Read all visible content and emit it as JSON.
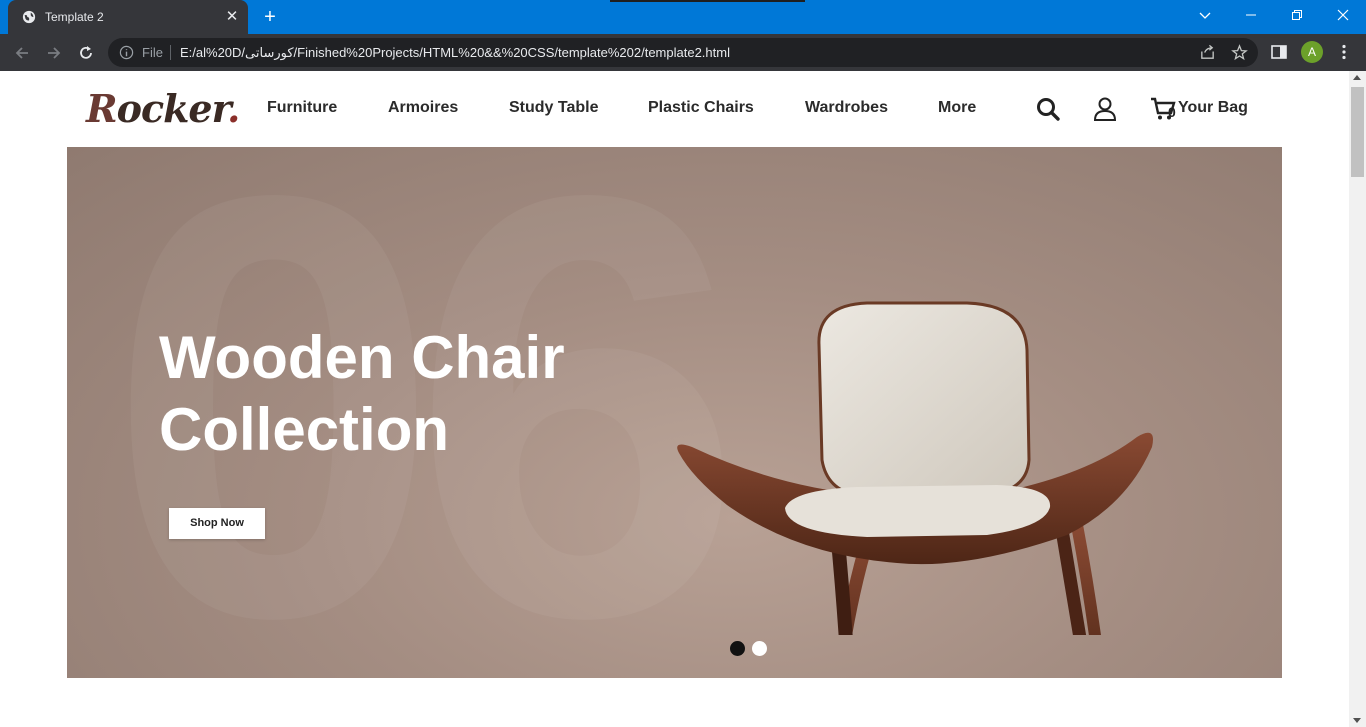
{
  "browser": {
    "tab_title": "Template 2",
    "tab_close": "✕",
    "new_tab": "+",
    "omnibox_scheme": "File",
    "url": "E:/al%20D/کورساتی/Finished%20Projects/HTML%20&&%20CSS/template%202/template2.html",
    "profile_initial": "A",
    "accent_color": "#0078d7"
  },
  "site": {
    "logo": {
      "first": "R",
      "rest": "ocker",
      "dot": "."
    },
    "nav": [
      "Furniture",
      "Armoires",
      "Study Table",
      "Plastic Chairs",
      "Wardrobes",
      "More"
    ],
    "bag_count": "0",
    "bag_label": "Your Bag"
  },
  "hero": {
    "bg_number": "06",
    "title": "Wooden Chair Collection",
    "button_label": "Shop Now",
    "slides": [
      {
        "color": "#111111",
        "active": true
      },
      {
        "color": "#ffffff",
        "active": false
      }
    ]
  }
}
